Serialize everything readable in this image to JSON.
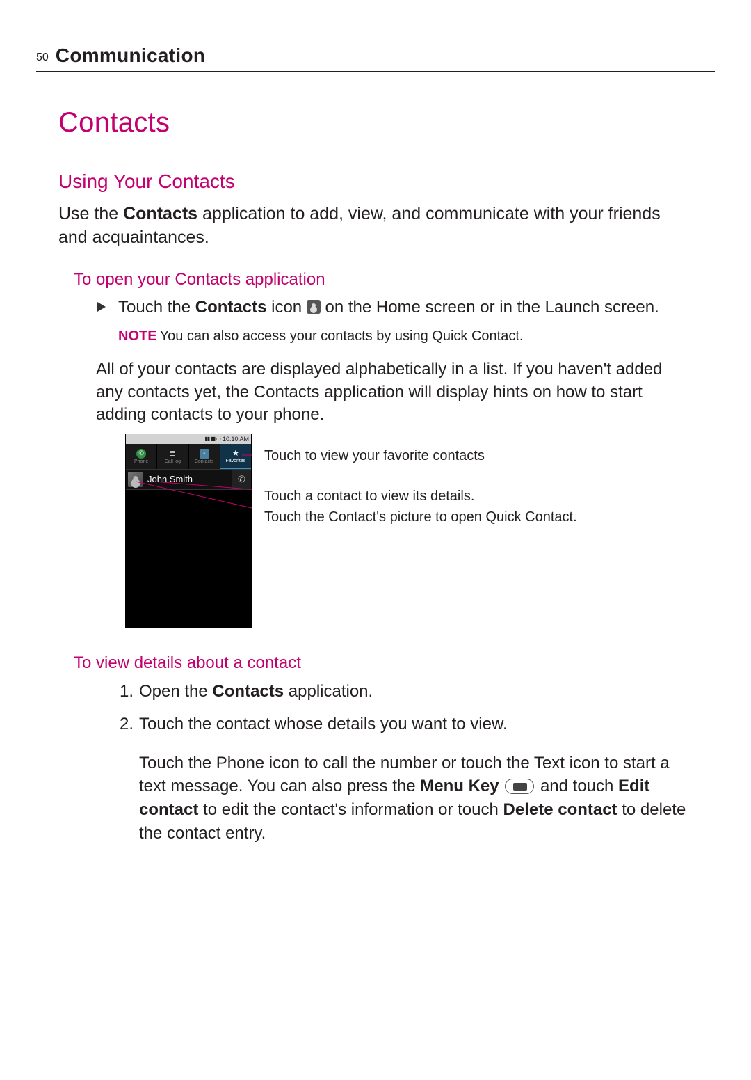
{
  "header": {
    "page_number": "50",
    "chapter": "Communication"
  },
  "title": "Contacts",
  "h2_using": "Using Your Contacts",
  "p_use_app_prefix": "Use the ",
  "p_use_app_bold": "Contacts",
  "p_use_app_suffix": " application to add, view, and communicate with your friends and acquaintances.",
  "h3_open": "To open your Contacts application",
  "li_touch_prefix": "Touch the ",
  "li_touch_bold": "Contacts",
  "li_touch_mid": " icon ",
  "li_touch_suffix": " on the Home screen or in the Launch screen.",
  "note": {
    "label": "NOTE",
    "text": "You can also access your contacts by using Quick Contact."
  },
  "p_all": "All of your contacts are displayed alphabetically in a list. If you haven't added any contacts yet, the Contacts application will display hints on how to start adding contacts to your phone.",
  "phone": {
    "time": "10:10 AM",
    "tabs": {
      "phone": "Phone",
      "calllog": "Call log",
      "contacts": "Contacts",
      "favorites": "Favorites"
    },
    "contact_name": "John Smith"
  },
  "callout1": "Touch to view your favorite contacts",
  "callout2": "Touch a contact to view its details.",
  "callout3": "Touch the Contact's picture to open Quick Contact.",
  "h3_view": "To view details about a contact",
  "ol": {
    "n1": "1.",
    "t1_prefix": "Open the ",
    "t1_bold": "Contacts",
    "t1_suffix": " application.",
    "n2": "2.",
    "t2": "Touch the contact whose details you want to view."
  },
  "p_final_1": "Touch the Phone icon to call the number or touch the Text icon to start a text message. You can also press the ",
  "p_final_bold1": "Menu Key",
  "p_final_2": " and touch ",
  "p_final_bold2": "Edit contact",
  "p_final_3": " to edit the contact's information or touch ",
  "p_final_bold3": "Delete contact",
  "p_final_4": " to delete the contact entry."
}
